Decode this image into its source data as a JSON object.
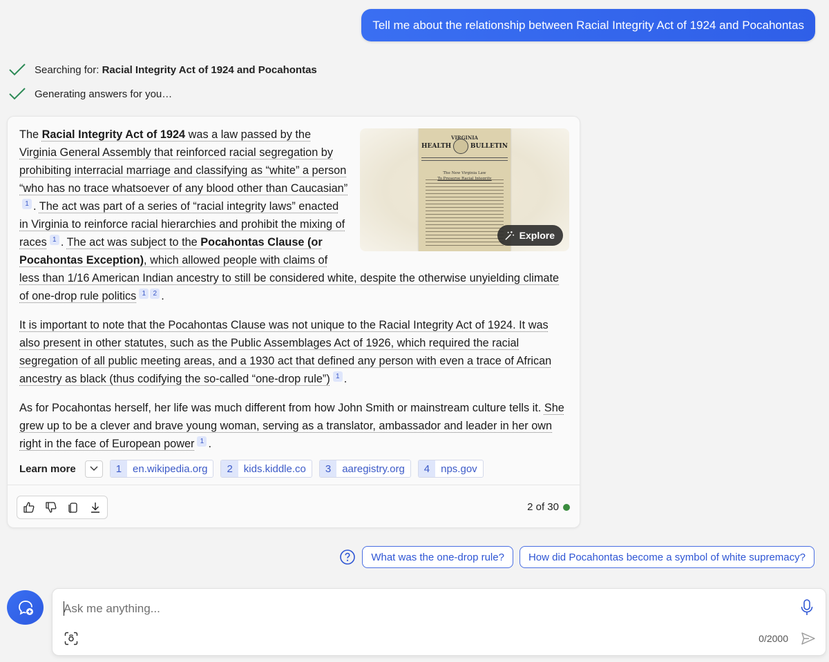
{
  "user_message": "Tell me about the relationship between Racial Integrity Act of 1924 and Pocahontas",
  "steps": [
    {
      "prefix": "Searching for: ",
      "bold": "Racial Integrity Act of 1924 and Pocahontas"
    },
    {
      "prefix": "Generating answers for you…",
      "bold": ""
    }
  ],
  "answer": {
    "p1": {
      "t0": "The ",
      "b0": "Racial Integrity Act of 1924",
      "r0": " was a law passed by the Virginia General Assembly that reinforced racial segregation by prohibiting interracial marriage and classifying as “white” a person “who has no trace whatsoever of any blood other than Caucasian”",
      "c0": "1",
      "t1": ". ",
      "r1": "The act was part of a series of “racial integrity laws” enacted in Virginia to reinforce racial hierarchies and prohibit the mixing of races",
      "c1": "1",
      "t2": ". ",
      "r2a": "The act was subject to the ",
      "b1": "Pocahontas Clause (or Pocahontas Exception)",
      "r2b": ", which allowed people with claims of less than 1/16 American Indian ancestry to still be considered white, despite the otherwise unyielding climate of one-drop rule politics",
      "c2": "1",
      "c3": "2",
      "t3": "."
    },
    "p2": {
      "r0": "It is important to note that the Pocahontas Clause was not unique to the Racial Integrity Act of 1924. It was also present in other statutes, such as the Public Assemblages Act of 1926, which required the racial segregation of all public meeting areas, and a 1930 act that defined any person with even a trace of African ancestry as black (thus codifying the so-called “one-drop rule”)",
      "c0": "1",
      "t0": "."
    },
    "p3": {
      "t0": "As for Pocahontas herself, her life was much different from how John Smith or mainstream culture tells it. ",
      "r0": "She grew up to be a clever and brave young woman, serving as a translator, ambassador and leader in her own right in the face of European power",
      "c0": "1",
      "t1": "."
    }
  },
  "image": {
    "masthead_top": "VIRGINIA",
    "masthead_left": "HEALTH",
    "masthead_right": "BULLETIN",
    "headline1": "The New Virginia Law",
    "headline2": "To Preserve Racial Integrity",
    "explore_label": "Explore"
  },
  "learn_more": {
    "label": "Learn more",
    "sources": [
      {
        "n": "1",
        "domain": "en.wikipedia.org"
      },
      {
        "n": "2",
        "domain": "kids.kiddle.co"
      },
      {
        "n": "3",
        "domain": "aaregistry.org"
      },
      {
        "n": "4",
        "domain": "nps.gov"
      }
    ]
  },
  "counter": "2 of 30",
  "suggestions": [
    "What was the one-drop rule?",
    "How did Pocahontas become a symbol of white supremacy?"
  ],
  "composer": {
    "placeholder": "Ask me anything...",
    "char_count": "0/2000"
  },
  "icons": {
    "check": "check-icon",
    "explore": "magic-wand-icon",
    "like": "thumbs-up-icon",
    "dislike": "thumbs-down-icon",
    "copy": "copy-icon",
    "export": "download-icon",
    "help": "question-icon",
    "new_topic": "new-topic-icon",
    "mic": "microphone-icon",
    "scan": "visual-search-icon",
    "send": "send-icon"
  },
  "colors": {
    "accent": "#2f5fe8",
    "link": "#3c5ac8",
    "check": "#2e8b57",
    "status_dot": "#3a8c3e"
  }
}
